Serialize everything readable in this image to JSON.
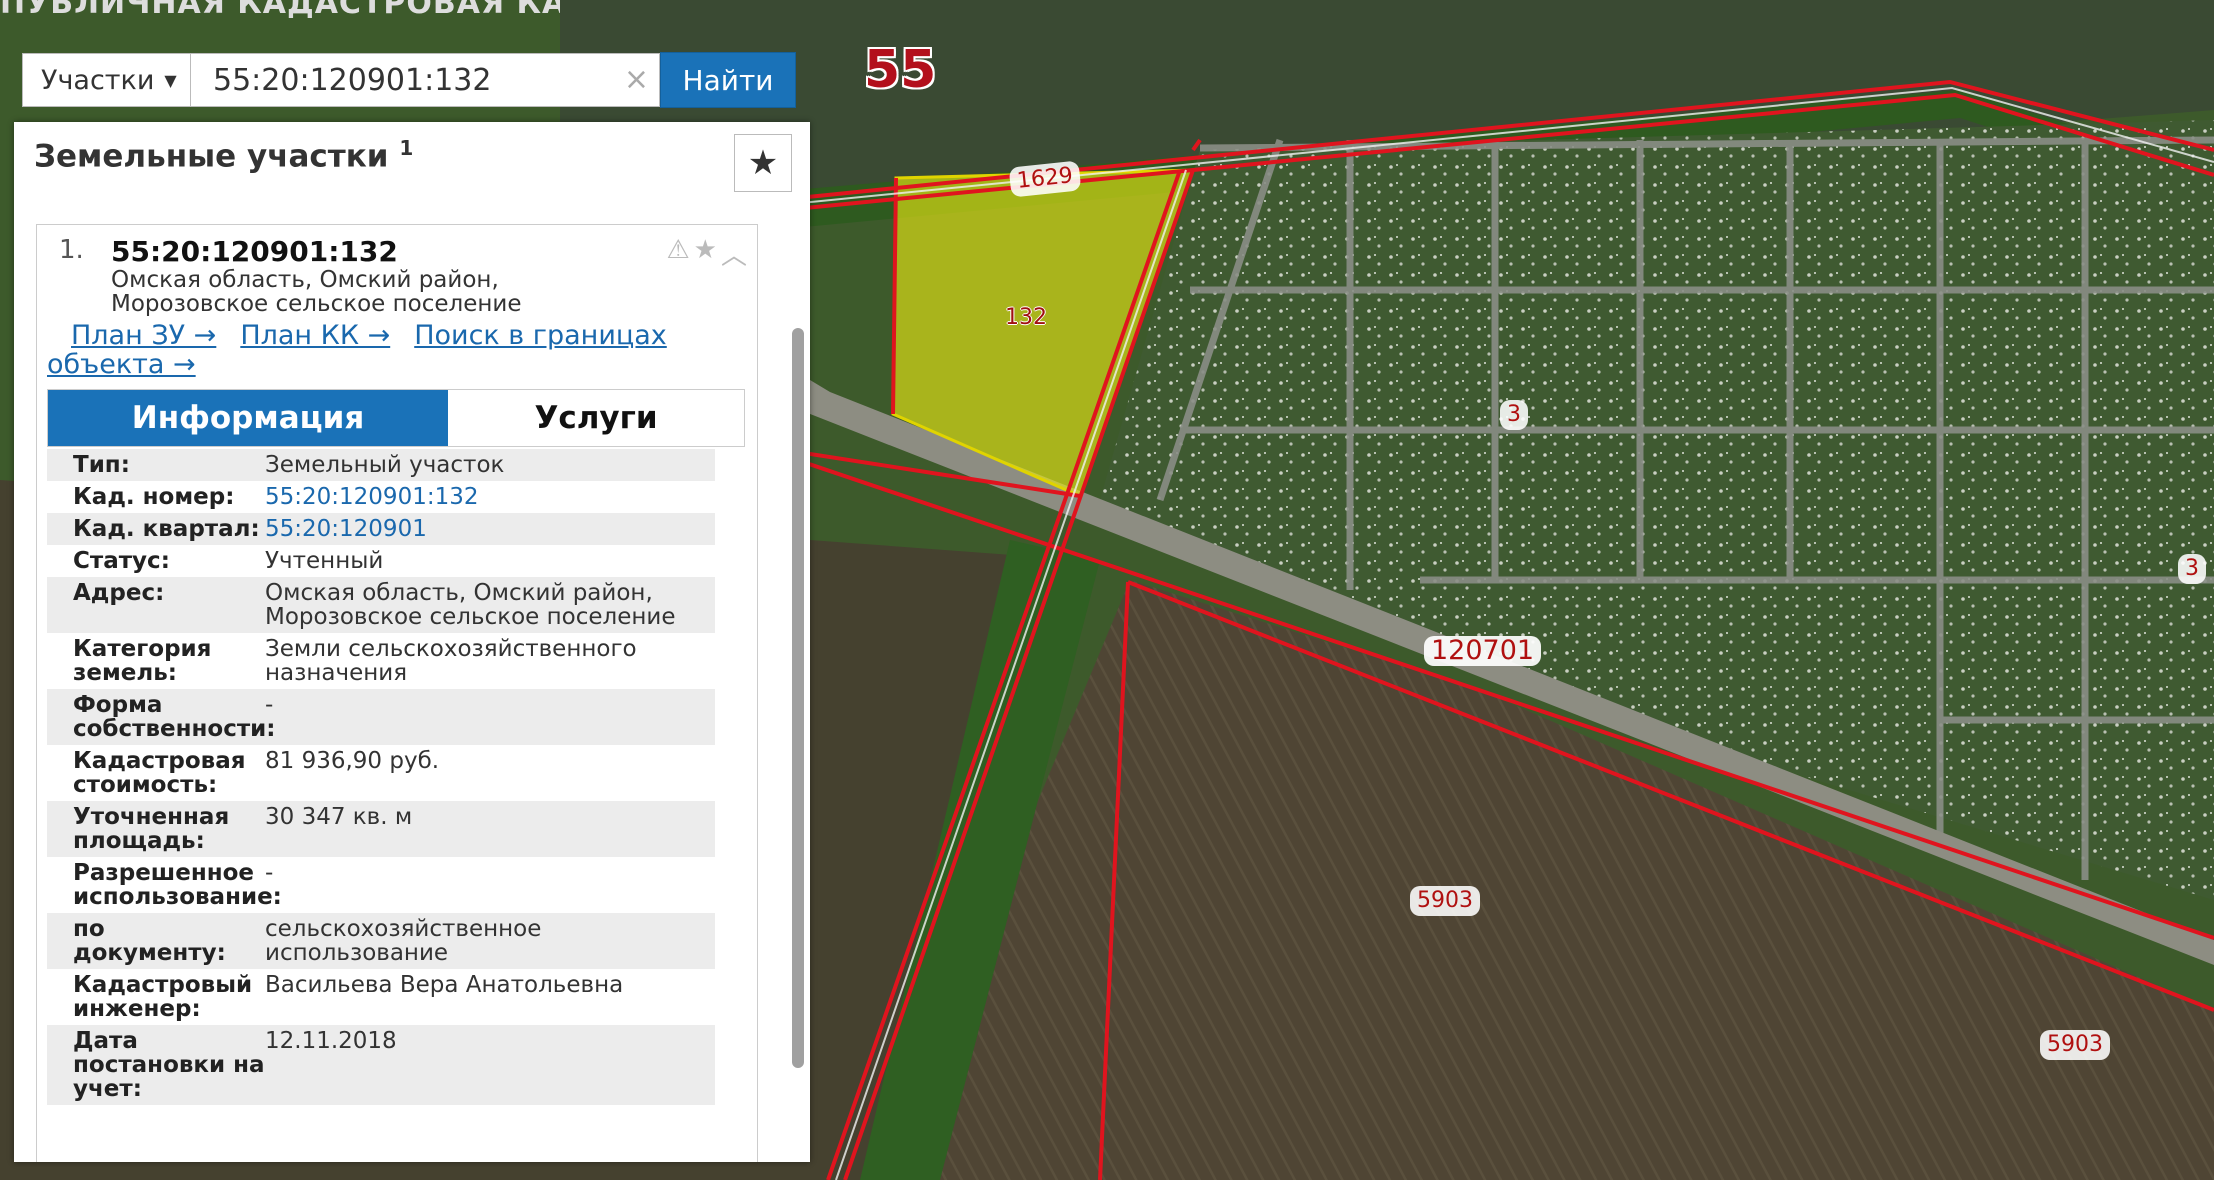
{
  "map": {
    "title": "ПУБЛИЧНАЯ КАДАСТРОВАЯ КАРТА",
    "labels": {
      "region": "55",
      "plot_1629": "1629",
      "plot_132": "132",
      "plot_3a": "3",
      "plot_3b": "3",
      "quarter": "120701",
      "plot_5903a": "5903",
      "plot_5903b": "5903"
    }
  },
  "search": {
    "type_label": "Участки",
    "value": "55:20:120901:132",
    "clear_glyph": "×",
    "button_label": "Найти"
  },
  "panel": {
    "title": "Земельные участки",
    "count": "1",
    "fav_glyph": "★"
  },
  "item": {
    "number": "1.",
    "cad_number": "55:20:120901:132",
    "address_line1": "Омская область, Омский район,",
    "address_line2": "Морозовское сельское поселение",
    "icons": {
      "warning": "⚠",
      "star": "★",
      "collapse": "︿"
    },
    "links": {
      "plan_zu": "План ЗУ →",
      "plan_kk": "План КК →",
      "search_in_bounds": "Поиск в границах",
      "search_in_bounds_2": "объекта →"
    },
    "tabs": {
      "info": "Информация",
      "services": "Услуги"
    },
    "attributes": [
      {
        "key": "Тип:",
        "value": "Земельный участок"
      },
      {
        "key": "Кад. номер:",
        "value": "55:20:120901:132",
        "link": true
      },
      {
        "key": "Кад. квартал:",
        "value": "55:20:120901",
        "link": true
      },
      {
        "key": "Статус:",
        "value": "Учтенный"
      },
      {
        "key": "Адрес:",
        "value": "Омская область, Омский район, Морозовское сельское поселение"
      },
      {
        "key": "Категория земель:",
        "value": "Земли сельскохозяйственного назначения"
      },
      {
        "key": "Форма собственности:",
        "value": "-"
      },
      {
        "key": "Кадастровая стоимость:",
        "value": "81 936,90 руб."
      },
      {
        "key": "Уточненная площадь:",
        "value": "30 347 кв. м"
      },
      {
        "key": "Разрешенное использование:",
        "value": "-"
      },
      {
        "key": "по документу:",
        "value": "сельскохозяйственное использование"
      },
      {
        "key": "Кадастровый инженер:",
        "value": "Васильева Вера Анатольевна"
      },
      {
        "key": "Дата постановки на учет:",
        "value": "12.11.2018"
      }
    ]
  }
}
